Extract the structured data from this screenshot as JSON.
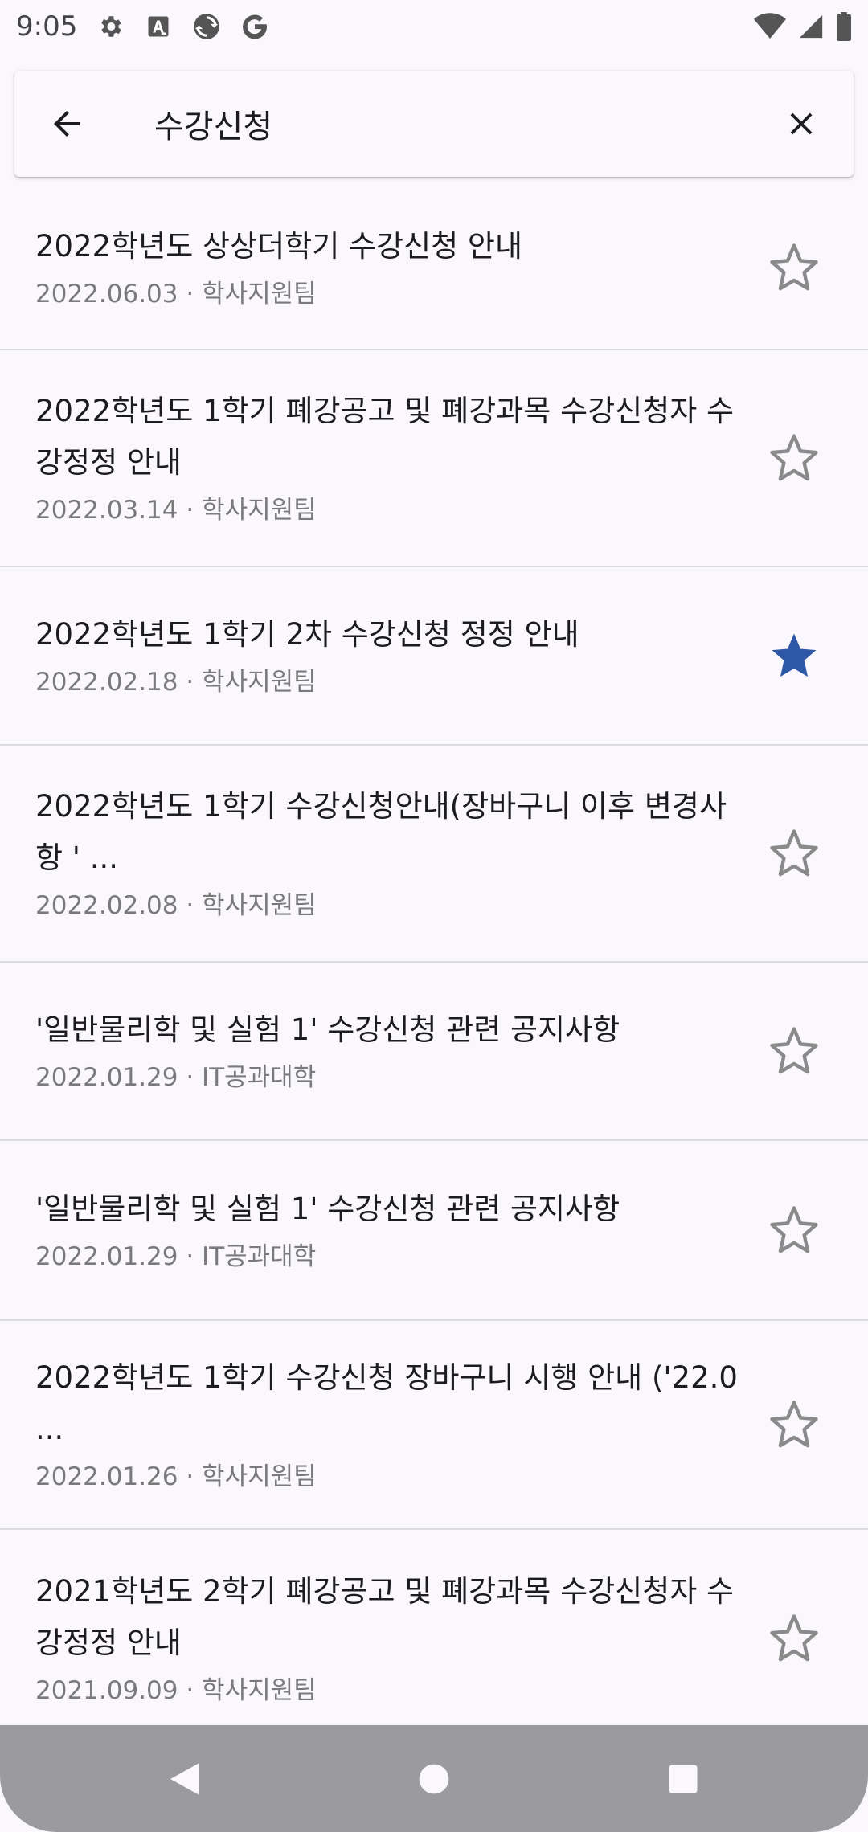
{
  "status_bar": {
    "time": "9:05",
    "left_icons": [
      "gear-icon",
      "text-a-icon",
      "sync-icon",
      "google-g-icon"
    ],
    "right_icons": [
      "wifi-icon",
      "signal-icon",
      "battery-icon"
    ]
  },
  "search": {
    "query": "수강신청"
  },
  "results": [
    {
      "title": "2022학년도 상상더학기 수강신청 안내",
      "meta": "2022.06.03 · 학사지원팀",
      "starred": false
    },
    {
      "title": "2022학년도 1학기 폐강공고 및 폐강과목 수강신청자 수강정정 안내",
      "meta": "2022.03.14 · 학사지원팀",
      "starred": false
    },
    {
      "title": "2022학년도 1학기 2차 수강신청 정정 안내",
      "meta": "2022.02.18 · 학사지원팀",
      "starred": true
    },
    {
      "title": "2022학년도 1학기 수강신청안내(장바구니 이후 변경사항 ' ...",
      "meta": "2022.02.08 · 학사지원팀",
      "starred": false
    },
    {
      "title": "'일반물리학 및 실험 1' 수강신청 관련 공지사항",
      "meta": "2022.01.29 · IT공과대학",
      "starred": false
    },
    {
      "title": "'일반물리학 및 실험 1' 수강신청 관련 공지사항",
      "meta": "2022.01.29 · IT공과대학",
      "starred": false
    },
    {
      "title": "2022학년도 1학기 수강신청 장바구니 시행 안내 ('22.0 ...",
      "meta": "2022.01.26 · 학사지원팀",
      "starred": false
    },
    {
      "title": "2021학년도 2학기 폐강공고 및 폐강과목 수강신청자 수강정정 안내",
      "meta": "2021.09.09 · 학사지원팀",
      "starred": false
    }
  ],
  "colors": {
    "star_active": "#2f57a8",
    "star_inactive": "#8a8a8a",
    "nav_bar": "#9b9b9e"
  },
  "nav_bar": {
    "buttons": [
      "back-triangle-icon",
      "home-circle-icon",
      "recents-square-icon"
    ]
  }
}
